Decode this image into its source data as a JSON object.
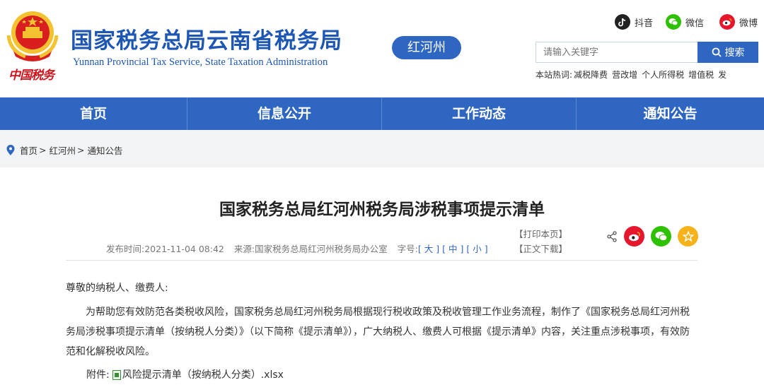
{
  "header": {
    "title_cn": "国家税务总局云南省税务局",
    "title_en": "Yunnan Provincial Tax Service, State Taxation Administration",
    "region": "红河州",
    "logo_text": "中国税务"
  },
  "social": [
    {
      "icon": "douyin-icon",
      "label": "抖音"
    },
    {
      "icon": "wechat-icon",
      "label": "微信"
    },
    {
      "icon": "weibo-icon",
      "label": "微博"
    }
  ],
  "search": {
    "placeholder": "请输入关键字",
    "button": "搜索",
    "hot_label": "本站热词:",
    "hot_words": [
      "减税降费",
      "营改增",
      "个人所得税",
      "增值税",
      "发"
    ]
  },
  "nav": [
    "首页",
    "信息公开",
    "工作动态",
    "通知公告"
  ],
  "breadcrumb": {
    "items": [
      "首页",
      "红河州",
      "通知公告"
    ],
    "sep": ">"
  },
  "article": {
    "title": "国家税务总局红河州税务局涉税事项提示清单",
    "print": "【打印本页】",
    "download": "【正文下载】",
    "publish_label": "发布时间:",
    "publish_time": "2021-11-04 08:42",
    "source_label": "来源:",
    "source": "国家税务总局红河州税务局办公室",
    "font_label": "字号:",
    "font_large": "大",
    "font_medium": "中",
    "font_small": "小",
    "greeting": "尊敬的纳税人、缴费人:",
    "body": "为帮助您有效防范各类税收风险，国家税务总局红河州税务局根据现行税收政策及税收管理工作业务流程，制作了《国家税务总局红河州税务局涉税事项提示清单（按纳税人分类）》（以下简称《提示清单》），广大纳税人、缴费人可根据《提示清单》内容，关注重点涉税事项，有效防范和化解税收风险。",
    "attach_label": "附件:",
    "attachment": "风险提示清单（按纳税人分类）.xlsx"
  },
  "colors": {
    "brand_blue": "#2e66c2",
    "title_blue": "#1d57b3",
    "logo_red": "#d0121b"
  }
}
